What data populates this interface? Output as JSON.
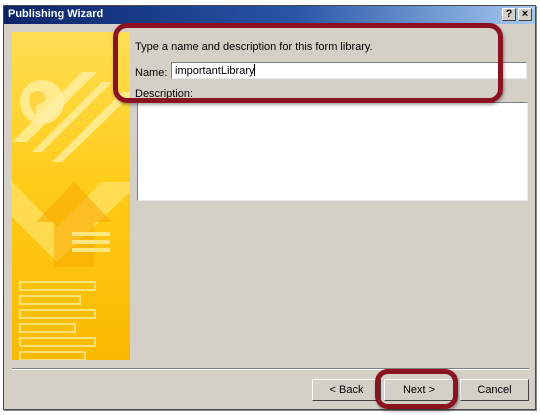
{
  "window": {
    "title": "Publishing Wizard",
    "help_label": "?",
    "close_label": "×"
  },
  "form": {
    "intro": "Type a name and description for this form library.",
    "name_label": "Name:",
    "name_value": "importantLibrary",
    "description_label": "Description:",
    "description_value": ""
  },
  "buttons": {
    "back": "< Back",
    "next": "Next >",
    "cancel": "Cancel"
  },
  "colors": {
    "title_gradient_start": "#0a246a",
    "dialog_face": "#d4d0c8",
    "banner_yellow": "#ffcc1a",
    "highlight": "#8b1220"
  },
  "icons": {
    "banner": "publishing-wizard-graphic"
  }
}
